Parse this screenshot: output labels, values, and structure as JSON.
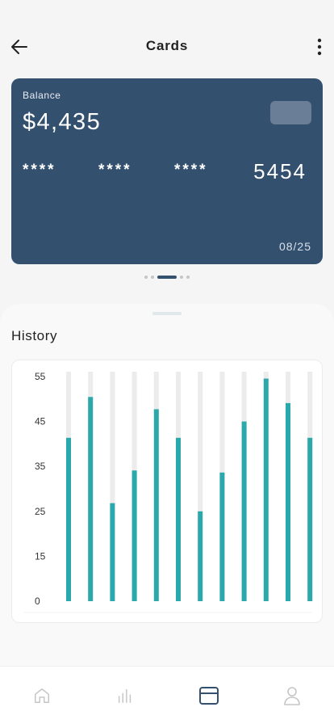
{
  "header": {
    "title": "Cards",
    "back_icon": "arrow-left-icon",
    "menu_icon": "more-vertical-icon"
  },
  "card": {
    "balance_label": "Balance",
    "balance_amount": "$4,435",
    "masked_groups": [
      "****",
      "****",
      "****"
    ],
    "last_four": "5454",
    "expiry": "08/25",
    "color": "#34506f"
  },
  "carousel": {
    "count": 5,
    "active_index": 2
  },
  "history": {
    "title": "History"
  },
  "chart_data": {
    "type": "bar",
    "title": "",
    "xlabel": "",
    "ylabel": "",
    "y_ticks": [
      "55",
      "45",
      "35",
      "25",
      "15",
      "0"
    ],
    "ylim": [
      0,
      55
    ],
    "values": [
      40,
      50,
      24,
      32,
      47,
      40,
      22,
      31.5,
      44,
      54.5,
      48.5,
      40
    ],
    "bar_color": "#2aa8ab",
    "track_color": "#ececec",
    "grid": false
  },
  "nav": {
    "items": [
      {
        "icon": "home-icon",
        "active": false
      },
      {
        "icon": "bar-chart-icon",
        "active": false
      },
      {
        "icon": "card-icon",
        "active": true
      },
      {
        "icon": "user-icon",
        "active": false
      }
    ]
  }
}
